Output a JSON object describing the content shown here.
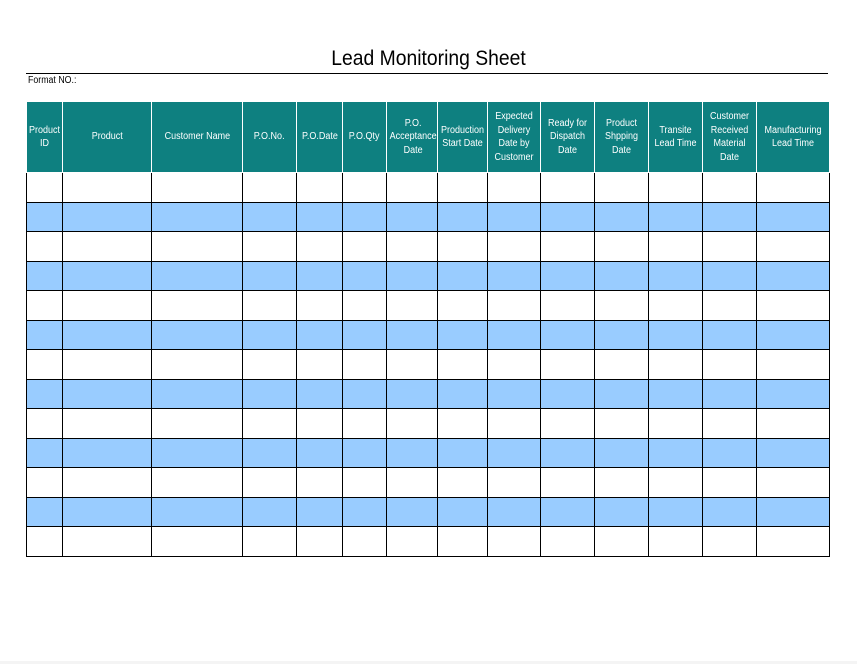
{
  "sheet": {
    "title": "Lead Monitoring Sheet",
    "format_label": "Format NO.:"
  },
  "table": {
    "columns": [
      "Product ID",
      "Product",
      "Customer Name",
      "P.O.No.",
      "P.O.Date",
      "P.O.Qty",
      "P.O. Acceptance Date",
      "Production Start Date",
      "Expected Delivery Date by Customer",
      "Ready for Dispatch Date",
      "Product Shpping Date",
      "Transite Lead Time",
      "Customer Received Material Date",
      "Manufacturing Lead Time"
    ],
    "row_count": 13,
    "colors": {
      "header_bg": "#0e8080",
      "header_text": "#ffffff",
      "stripe": "#99ccff",
      "row": "#ffffff"
    }
  }
}
